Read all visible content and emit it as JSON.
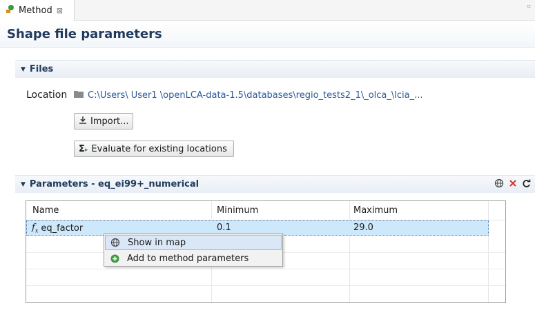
{
  "tab": {
    "label": "Method",
    "close_glyph": "⊠",
    "icon": "method-icon"
  },
  "form": {
    "title": "Shape file parameters"
  },
  "files_section": {
    "title": "Files",
    "location_label": "Location",
    "location_path": "C:\\Users\\ User1 \\openLCA-data-1.5\\databases\\regio_tests2_1\\_olca_\\lcia_...",
    "import_label": "Import...",
    "evaluate_label": "Evaluate for existing locations"
  },
  "params_section": {
    "title": "Parameters - eq_ei99+_numerical",
    "actions": [
      "globe-icon",
      "delete-icon",
      "refresh-icon"
    ]
  },
  "table": {
    "columns": [
      "Name",
      "Minimum",
      "Maximum"
    ],
    "rows": [
      {
        "name": "eq_factor",
        "minimum": "0.1",
        "maximum": "29.0"
      }
    ]
  },
  "context_menu": {
    "items": [
      {
        "label": "Show in map",
        "icon": "globe-icon"
      },
      {
        "label": "Add to method parameters",
        "icon": "add-icon"
      }
    ]
  },
  "colors": {
    "header_text": "#1f3a5c",
    "path_link": "#2a5a9a",
    "delete": "#d9302c",
    "selection": "#cde8fb",
    "add_green": "#3a9a3a"
  }
}
